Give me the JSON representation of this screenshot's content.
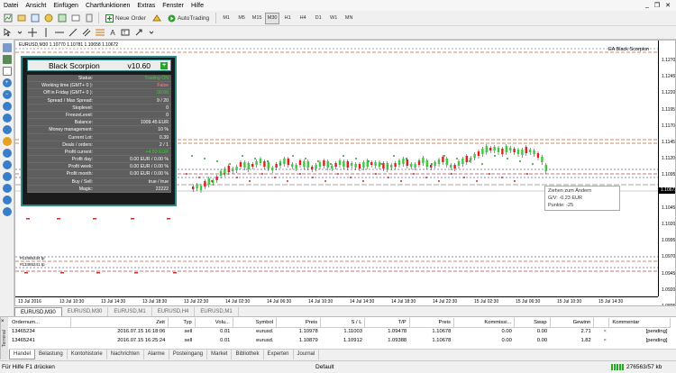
{
  "menu": [
    "Datei",
    "Ansicht",
    "Einfügen",
    "Chartfunktionen",
    "Extras",
    "Fenster",
    "Hilfe"
  ],
  "window_controls": [
    "_",
    "❐",
    "✕"
  ],
  "toolbar": {
    "neue_order": "Neue Order",
    "autotrading": "AutoTrading",
    "timeframes": [
      "M1",
      "M5",
      "M15",
      "M30",
      "H1",
      "H4",
      "D1",
      "W1",
      "MN"
    ],
    "active_timeframe": "M30"
  },
  "chart": {
    "header": "EURUSD,M30  1.10770  1.10781  1.10658  1.10672",
    "ea_label": "EA Black Scorpion",
    "current_price": "1.10672",
    "price_ticks": [
      "1.1270",
      "1.1245",
      "1.1220",
      "1.1195",
      "1.1170",
      "1.1145",
      "1.1120",
      "1.1095",
      "1.1070",
      "1.1045",
      "1.1020",
      "1.0995",
      "1.0970",
      "1.0945",
      "1.0920",
      "1.0895"
    ],
    "time_ticks": [
      "13 Jul 2016",
      "13 Jul 10:30",
      "13 Jul 14:30",
      "13 Jul 18:30",
      "13 Jul 22:30",
      "14 Jul 02:30",
      "14 Jul 06:30",
      "14 Jul 10:30",
      "14 Jul 14:30",
      "14 Jul 18:30",
      "14 Jul 22:30",
      "15 Jul 02:30",
      "15 Jul 06:30",
      "15 Jul 10:30",
      "15 Jul 14:30"
    ],
    "order_labels": [
      "#13465234 tp",
      "#13465241 tp"
    ],
    "tooltip": [
      "Ziehen zum Ändern",
      "G/V: -0.23 EUR",
      "Punkte: -25"
    ]
  },
  "panel": {
    "name": "Black Scorpion",
    "version": "v10.60",
    "rows": [
      {
        "k": "Status:",
        "v": "Trading ON",
        "c": "#3ec83e"
      },
      {
        "k": "Working time (GMT+ 0 ):",
        "v": "False",
        "c": "#ff8080"
      },
      {
        "k": "Off in Friday (GMT+ 0 ):",
        "v": "00:00",
        "c": "#3ec83e"
      },
      {
        "k": "Spread  /  Max Spread:",
        "v": "9  /  20",
        "c": "#ffffff"
      },
      {
        "k": "Stoplevel:",
        "v": "0",
        "c": "#ffffff"
      },
      {
        "k": "FreezeLevel:",
        "v": "0",
        "c": "#ffffff"
      },
      {
        "k": "Balance:",
        "v": "1009.45  EUR",
        "c": "#ffffff"
      },
      {
        "k": "Money management:",
        "v": "10 %",
        "c": "#ffffff"
      },
      {
        "k": "Current Lot:",
        "v": "0.39",
        "c": "#ffffff"
      },
      {
        "k": "Deals  /  orders:",
        "v": "2  /  1",
        "c": "#ffffff"
      },
      {
        "k": "Profit current:",
        "v": "+4.53 EUR",
        "c": "#3ec83e"
      },
      {
        "k": "Profit day:",
        "v": "0.00 EUR  /  0.00 %",
        "c": "#ffffff"
      },
      {
        "k": "Profit week:",
        "v": "0.00 EUR  /  0.00 %",
        "c": "#ffffff"
      },
      {
        "k": "Profit month:",
        "v": "0.00 EUR  /  0.00 %",
        "c": "#ffffff"
      },
      {
        "k": "Buy  /  Sell:",
        "v": "true  /  true",
        "c": "#ffffff"
      },
      {
        "k": "Magic:",
        "v": "22222",
        "c": "#ffffff"
      }
    ]
  },
  "chart_tabs": [
    "EURUSD,M30",
    "EURUSD,M30",
    "EURUSD,M1",
    "EURUSD,H4",
    "EURUSD,M1"
  ],
  "terminal": {
    "side_label": "Terminal",
    "columns": [
      "Ordernum...",
      "Zeit",
      "Typ",
      "Volu...",
      "Symbol",
      "Preis",
      "S / L",
      "T/P",
      "Preis",
      "Kommissi...",
      "Swap",
      "Gewinn",
      "",
      "Kommentar"
    ],
    "rows": [
      [
        "13465234",
        "2016.07.15 16:18:06",
        "sell",
        "0.01",
        "eurusd.",
        "1.10978",
        "1.11003",
        "1.09478",
        "1.10678",
        "0.00",
        "0.00",
        "2.71",
        "×",
        "[pending]"
      ],
      [
        "13465241",
        "2016.07.15 16:25:24",
        "sell",
        "0.01",
        "eurusd.",
        "1.10879",
        "1.10912",
        "1.09388",
        "1.10678",
        "0.00",
        "0.00",
        "1.82",
        "×",
        "[pending]"
      ]
    ]
  },
  "bottom_tabs": [
    "Handel",
    "Belastung",
    "Kontohistorie",
    "Nachrichten",
    "Alarme",
    "Posteingang",
    "Market",
    "Bibliothek",
    "Experten",
    "Journal"
  ],
  "status": {
    "help": "Für Hilfe F1 drücken",
    "profile": "Default",
    "traffic": "276563/57 kb"
  }
}
